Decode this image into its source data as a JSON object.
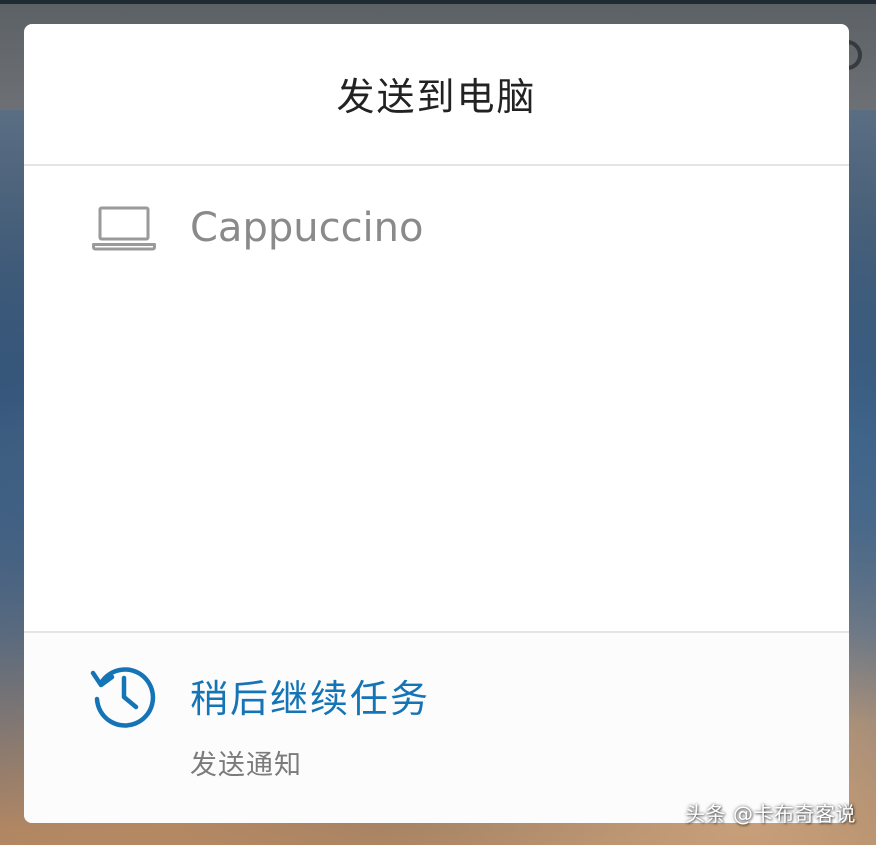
{
  "dialog": {
    "title": "发送到电脑"
  },
  "devices": [
    {
      "icon": "laptop-icon",
      "name": "Cappuccino"
    }
  ],
  "footer": {
    "icon": "history-icon",
    "action_label": "稍后继续任务",
    "sub_label": "发送通知"
  },
  "watermark": "头条 @卡布奇客说",
  "colors": {
    "accent": "#1574b6",
    "device_text": "#8a8a8a",
    "title_text": "#222222",
    "divider": "#e4e4e4"
  }
}
